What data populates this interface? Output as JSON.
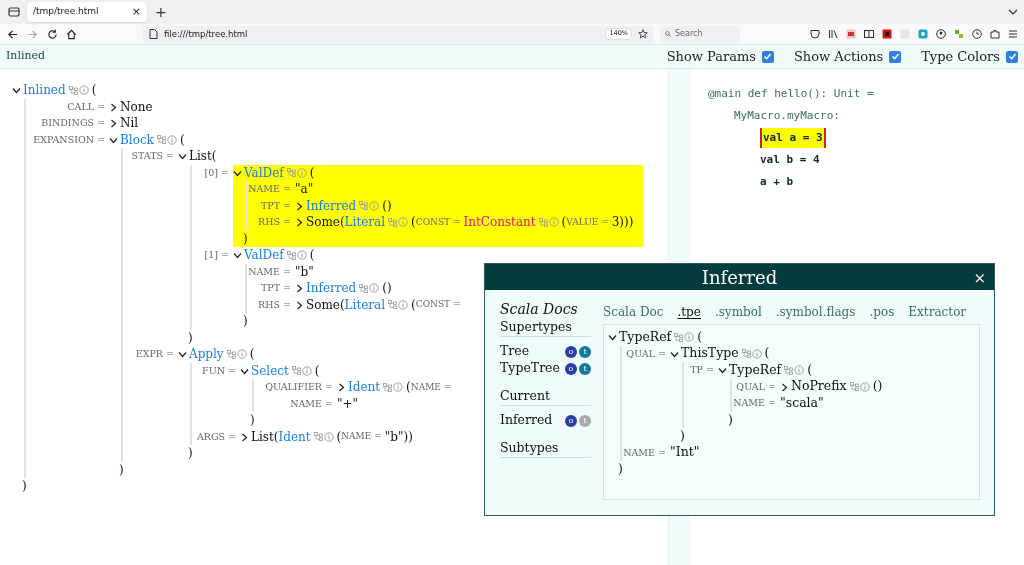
{
  "browser": {
    "tab": {
      "title": "/tmp/tree.html",
      "close": "×"
    },
    "new_tab": "+",
    "url": "file:///tmp/tree.html",
    "zoom": "140%",
    "search": {
      "placeholder": "Search"
    }
  },
  "header": {
    "title": "Inlined",
    "options": [
      {
        "label": "Show Params",
        "checked": true
      },
      {
        "label": "Show Actions",
        "checked": true
      },
      {
        "label": "Type Colors",
        "checked": true
      }
    ]
  },
  "tree": {
    "expanded": true,
    "parts": [
      {
        "kind": "node",
        "text": "Inlined"
      },
      {
        "kind": "plain",
        "text": "("
      }
    ],
    "closing": ")",
    "children": [
      {
        "label": "CALL =",
        "expanded": false,
        "parts": [
          {
            "kind": "plain",
            "text": "None"
          }
        ]
      },
      {
        "label": "BINDINGS =",
        "expanded": false,
        "parts": [
          {
            "kind": "plain",
            "text": "Nil"
          }
        ]
      },
      {
        "label": "EXPANSION =",
        "expanded": true,
        "parts": [
          {
            "kind": "node",
            "text": "Block"
          },
          {
            "kind": "plain",
            "text": "("
          }
        ],
        "closing": ")",
        "children": [
          {
            "label": "STATS =",
            "expanded": true,
            "parts": [
              {
                "kind": "plain",
                "text": "List("
              }
            ],
            "closing": ")",
            "children": [
              {
                "label": "[0] =",
                "expanded": true,
                "highlighted": true,
                "parts": [
                  {
                    "kind": "node",
                    "text": "ValDef"
                  },
                  {
                    "kind": "plain",
                    "text": "("
                  }
                ],
                "closing": ")",
                "children": [
                  {
                    "label": "NAME =",
                    "parts": [
                      {
                        "kind": "plain",
                        "text": "\"a\""
                      }
                    ]
                  },
                  {
                    "label": "TPT =",
                    "expanded": false,
                    "parts": [
                      {
                        "kind": "node",
                        "text": "Inferred"
                      },
                      {
                        "kind": "plain",
                        "text": "()"
                      }
                    ]
                  },
                  {
                    "label": "RHS =",
                    "expanded": false,
                    "parts": [
                      {
                        "kind": "plain",
                        "text": "Some("
                      },
                      {
                        "kind": "node",
                        "text": "Literal"
                      },
                      {
                        "kind": "plain",
                        "text": "("
                      },
                      {
                        "kind": "field",
                        "text": "CONST ="
                      },
                      {
                        "kind": "special",
                        "text": "IntConstant"
                      },
                      {
                        "kind": "plain",
                        "text": "("
                      },
                      {
                        "kind": "field",
                        "text": "VALUE ="
                      },
                      {
                        "kind": "plain",
                        "text": "3)))"
                      }
                    ]
                  }
                ]
              },
              {
                "label": "[1] =",
                "expanded": true,
                "highlighted": false,
                "parts": [
                  {
                    "kind": "node",
                    "text": "ValDef"
                  },
                  {
                    "kind": "plain",
                    "text": "("
                  }
                ],
                "closing": ")",
                "children": [
                  {
                    "label": "NAME =",
                    "parts": [
                      {
                        "kind": "plain",
                        "text": "\"b\""
                      }
                    ]
                  },
                  {
                    "label": "TPT =",
                    "expanded": false,
                    "parts": [
                      {
                        "kind": "node",
                        "text": "Inferred"
                      },
                      {
                        "kind": "plain",
                        "text": "()"
                      }
                    ]
                  },
                  {
                    "label": "RHS =",
                    "expanded": false,
                    "parts": [
                      {
                        "kind": "plain",
                        "text": "Some("
                      },
                      {
                        "kind": "node",
                        "text": "Literal"
                      },
                      {
                        "kind": "plain",
                        "text": "("
                      },
                      {
                        "kind": "field",
                        "text": "CONST ="
                      }
                    ]
                  }
                ]
              }
            ]
          },
          {
            "label": "EXPR =",
            "expanded": true,
            "parts": [
              {
                "kind": "node",
                "text": "Apply"
              },
              {
                "kind": "plain",
                "text": "("
              }
            ],
            "closing": ")",
            "children": [
              {
                "label": "FUN =",
                "expanded": true,
                "parts": [
                  {
                    "kind": "node",
                    "text": "Select"
                  },
                  {
                    "kind": "plain",
                    "text": "("
                  }
                ],
                "closing": ")",
                "children": [
                  {
                    "label": "QUALIFIER =",
                    "expanded": false,
                    "parts": [
                      {
                        "kind": "node",
                        "text": "Ident"
                      },
                      {
                        "kind": "plain",
                        "text": "("
                      },
                      {
                        "kind": "field",
                        "text": "NAME ="
                      }
                    ]
                  },
                  {
                    "label": "NAME =",
                    "parts": [
                      {
                        "kind": "plain",
                        "text": "\"+\""
                      }
                    ]
                  }
                ]
              },
              {
                "label": "ARGS =",
                "expanded": false,
                "parts": [
                  {
                    "kind": "plain",
                    "text": "List("
                  },
                  {
                    "kind": "node",
                    "text": "Ident"
                  },
                  {
                    "kind": "plain",
                    "text": "("
                  },
                  {
                    "kind": "field",
                    "text": "NAME ="
                  },
                  {
                    "kind": "plain",
                    "text": "\"b\"))"
                  }
                ]
              }
            ]
          }
        ]
      }
    ]
  },
  "code": [
    {
      "text": "@main def hello(): Unit =",
      "in_macro": false,
      "children": [
        {
          "text": "MyMacro.myMacro:",
          "in_macro": false,
          "children": [
            {
              "text": "val a = 3",
              "in_macro": true,
              "highlighted": true
            },
            {
              "text": "val b = 4",
              "in_macro": true,
              "highlighted": false
            },
            {
              "text": "a + b",
              "in_macro": true,
              "highlighted": false
            }
          ]
        }
      ]
    }
  ],
  "dialog": {
    "title": "Inferred",
    "close": "×",
    "docs_title": "Scala Docs",
    "sections": [
      {
        "title": "Supertypes",
        "items": [
          {
            "name": "Tree",
            "badges": [
              {
                "kind": "object",
                "text": "o",
                "enabled": true
              },
              {
                "kind": "trait",
                "text": "t",
                "enabled": true
              }
            ]
          },
          {
            "name": "TypeTree",
            "badges": [
              {
                "kind": "object",
                "text": "o",
                "enabled": true
              },
              {
                "kind": "trait",
                "text": "t",
                "enabled": true
              }
            ]
          }
        ]
      },
      {
        "title": "Current",
        "items": [
          {
            "name": "Inferred",
            "badges": [
              {
                "kind": "object",
                "text": "o",
                "enabled": true
              },
              {
                "kind": "trait",
                "text": "t",
                "enabled": false
              }
            ]
          }
        ]
      },
      {
        "title": "Subtypes"
      }
    ],
    "tabs": [
      {
        "label": "Scala Doc",
        "selected": false
      },
      {
        "label": ".tpe",
        "selected": true
      },
      {
        "label": ".symbol",
        "selected": false
      },
      {
        "label": ".symbol.flags",
        "selected": false
      },
      {
        "label": ".pos",
        "selected": false
      },
      {
        "label": "Extractor",
        "selected": false
      }
    ],
    "tree": {
      "expanded": true,
      "parts": [
        {
          "kind": "type",
          "text": "TypeRef"
        },
        {
          "kind": "plain",
          "text": "("
        }
      ],
      "closing": ")",
      "children": [
        {
          "label": "QUAL =",
          "expanded": true,
          "parts": [
            {
              "kind": "type",
              "text": "ThisType"
            },
            {
              "kind": "plain",
              "text": "("
            }
          ],
          "closing": ")",
          "children": [
            {
              "label": "TP =",
              "expanded": true,
              "parts": [
                {
                  "kind": "type",
                  "text": "TypeRef"
                },
                {
                  "kind": "plain",
                  "text": "("
                }
              ],
              "closing": ")",
              "children": [
                {
                  "label": "QUAL =",
                  "expanded": false,
                  "parts": [
                    {
                      "kind": "type",
                      "text": "NoPrefix"
                    },
                    {
                      "kind": "plain",
                      "text": "()"
                    }
                  ]
                },
                {
                  "label": "NAME =",
                  "parts": [
                    {
                      "kind": "plain",
                      "text": "\"scala\""
                    }
                  ]
                }
              ]
            }
          ]
        },
        {
          "label": "NAME =",
          "parts": [
            {
              "kind": "plain",
              "text": "\"Int\""
            }
          ]
        }
      ]
    }
  }
}
